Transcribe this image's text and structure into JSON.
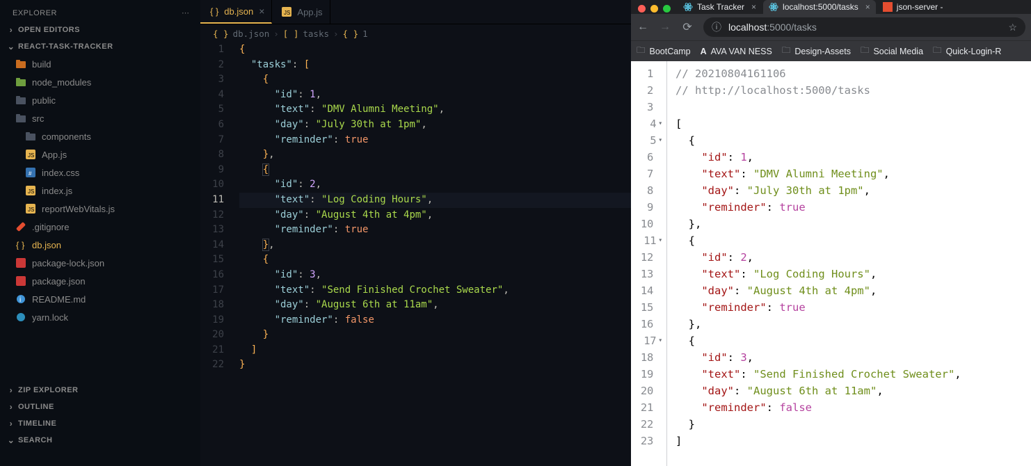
{
  "vscode": {
    "explorer_title": "EXPLORER",
    "sections": {
      "open_editors": "OPEN EDITORS",
      "project": "REACT-TASK-TRACKER",
      "zip": "ZIP EXPLORER",
      "outline": "OUTLINE",
      "timeline": "TIMELINE",
      "search": "SEARCH"
    },
    "tree": {
      "build": "build",
      "node_modules": "node_modules",
      "public": "public",
      "src": "src",
      "components": "components",
      "app_js": "App.js",
      "index_css": "index.css",
      "index_js": "index.js",
      "rwv": "reportWebVitals.js",
      "gitignore": ".gitignore",
      "db_json": "db.json",
      "pkg_lock": "package-lock.json",
      "pkg": "package.json",
      "readme": "README.md",
      "yarn": "yarn.lock"
    },
    "tabs": {
      "db_json": "db.json",
      "app_js": "App.js"
    },
    "breadcrumb": {
      "file": "db.json",
      "arr": "tasks",
      "obj": "1"
    },
    "code": {
      "tasks_key": "\"tasks\"",
      "id_key": "\"id\"",
      "text_key": "\"text\"",
      "day_key": "\"day\"",
      "reminder_key": "\"reminder\"",
      "id1": "1",
      "text1": "\"DMV Alumni Meeting\"",
      "day1": "\"July 30th at 1pm\"",
      "rem1": "true",
      "id2": "2",
      "text2": "\"Log Coding Hours\"",
      "day2": "\"August 4th at 4pm\"",
      "rem2": "true",
      "id3": "3",
      "text3": "\"Send Finished Crochet Sweater\"",
      "day3": "\"August 6th at 11am\"",
      "rem3": "false"
    },
    "linenums": [
      "1",
      "2",
      "3",
      "4",
      "5",
      "6",
      "7",
      "8",
      "9",
      "10",
      "11",
      "12",
      "13",
      "14",
      "15",
      "16",
      "17",
      "18",
      "19",
      "20",
      "21",
      "22"
    ]
  },
  "chrome": {
    "tabs": {
      "t1": "Task Tracker",
      "t2": "localhost:5000/tasks",
      "t3": "json-server - "
    },
    "url_host": "localhost",
    "url_path": ":5000/tasks",
    "bookmarks": {
      "b1": "BootCamp",
      "b2": "AVA VAN NESS",
      "b3": "Design-Assets",
      "b4": "Social Media",
      "b5": "Quick-Login-R"
    },
    "viewer": {
      "comment1": "// 20210804161106",
      "comment2": "// http://localhost:5000/tasks",
      "id_key": "\"id\"",
      "text_key": "\"text\"",
      "day_key": "\"day\"",
      "reminder_key": "\"reminder\"",
      "id1": "1",
      "text1": "\"DMV Alumni Meeting\"",
      "day1": "\"July 30th at 1pm\"",
      "rem1": "true",
      "id2": "2",
      "text2": "\"Log Coding Hours\"",
      "day2": "\"August 4th at 4pm\"",
      "rem2": "true",
      "id3": "3",
      "text3": "\"Send Finished Crochet Sweater\"",
      "day3": "\"August 6th at 11am\"",
      "rem3": "false",
      "lines": [
        "1",
        "2",
        "3",
        "4",
        "5",
        "6",
        "7",
        "8",
        "9",
        "10",
        "11",
        "12",
        "13",
        "14",
        "15",
        "16",
        "17",
        "18",
        "19",
        "20",
        "21",
        "22",
        "23"
      ]
    }
  }
}
